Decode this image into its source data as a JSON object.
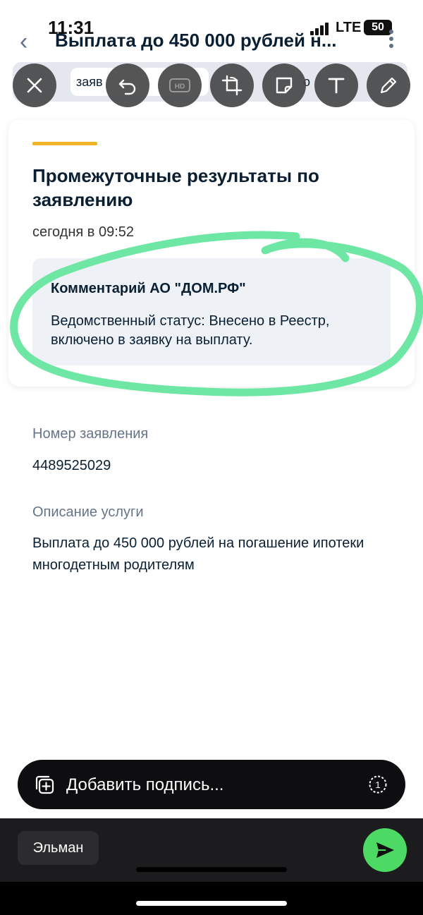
{
  "status_bar": {
    "time": "11:31",
    "network": "LTE",
    "battery": "50"
  },
  "header": {
    "title": "Выплата до 450 000 рублей н..."
  },
  "tabs": {
    "left_partial": "заяв",
    "right_partial": "о"
  },
  "editor_tools": [
    "close-icon",
    "undo-icon",
    "hd-icon",
    "crop-rotate-icon",
    "sticker-icon",
    "text-icon",
    "pencil-icon"
  ],
  "card": {
    "title": "Промежуточные результаты по заявлению",
    "date": "сегодня в 09:52",
    "comment_title": "Комментарий АО \"ДОМ.РФ\"",
    "comment_text": "Ведомственный статус: Внесено в Реестр, включено в заявку на выплату."
  },
  "details": {
    "number_label": "Номер заявления",
    "number_value": "4489525029",
    "service_label": "Описание услуги",
    "service_value": "Выплата до 450 000 рублей на погашение ипотеки многодетным родителям"
  },
  "caption": {
    "placeholder": "Добавить подпись...",
    "timer": "1"
  },
  "recipient": {
    "name": "Эльман"
  },
  "colors": {
    "accent": "#f0b429",
    "highlight": "#6ee7a4",
    "send": "#4cd964"
  }
}
